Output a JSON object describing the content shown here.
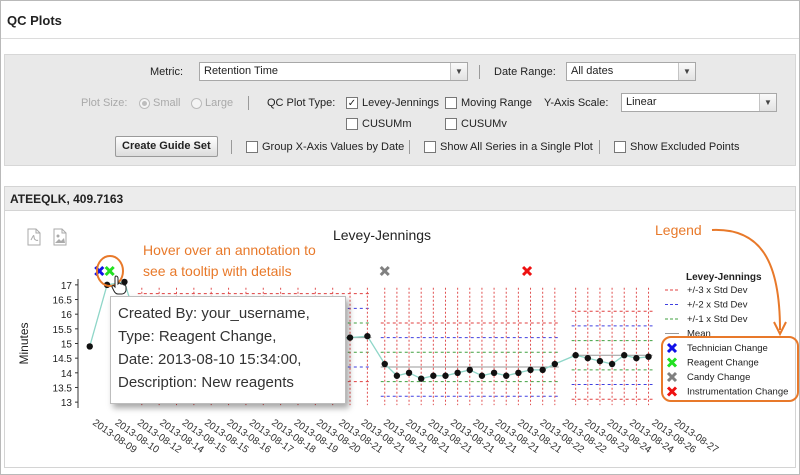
{
  "page": {
    "title": "QC Plots"
  },
  "controls": {
    "metric_label": "Metric:",
    "metric_value": "Retention Time",
    "date_range_label": "Date Range:",
    "date_range_value": "All dates",
    "plot_size_label": "Plot Size:",
    "plot_size_small": "Small",
    "plot_size_large": "Large",
    "qc_plot_type_label": "QC Plot Type:",
    "levey_jennings": "Levey-Jennings",
    "moving_range": "Moving Range",
    "cusumm": "CUSUMm",
    "cusumv": "CUSUMv",
    "y_axis_scale_label": "Y-Axis Scale:",
    "y_axis_scale_value": "Linear",
    "create_guide_set": "Create Guide Set",
    "group_x_axis": "Group X-Axis Values by Date",
    "show_all_series": "Show All Series in a Single Plot",
    "show_excluded": "Show Excluded Points"
  },
  "plot": {
    "header": "ATEEQLK, 409.7163",
    "callout_hover_line1": "Hover over an annotation to",
    "callout_hover_line2": "see a tooltip with details",
    "callout_legend": "Legend",
    "icons": [
      "pdf-export-icon",
      "png-export-icon",
      "pointer-hand-icon"
    ],
    "tooltip": {
      "created_by": "Created By: your_username,",
      "type": "Type: Reagent Change,",
      "date": "Date: 2013-08-10 15:34:00,",
      "description": "Description: New reagents"
    }
  },
  "chart_data": {
    "type": "line",
    "title": "Levey-Jennings",
    "ylabel": "Minutes",
    "xlabel": "",
    "ylim": [
      12.8,
      17.2
    ],
    "yticks": [
      13,
      13.5,
      14,
      14.5,
      15,
      15.5,
      16,
      16.5,
      17
    ],
    "x": [
      "2013-08-09",
      "2013-08-10",
      "2013-08-12",
      "2013-08-14",
      "2013-08-15",
      "2013-08-15",
      "2013-08-16",
      "2013-08-17",
      "2013-08-18",
      "2013-08-19",
      "2013-08-20",
      "2013-08-21",
      "2013-08-21",
      "2013-08-21",
      "2013-08-21",
      "2013-08-21",
      "2013-08-21",
      "2013-08-21",
      "2013-08-21",
      "2013-08-21",
      "2013-08-22",
      "2013-08-22",
      "2013-08-23",
      "2013-08-24",
      "2013-08-24",
      "2013-08-26",
      "2013-08-27"
    ],
    "xtick_labels": [
      "2013-08-09",
      "2013-08-10",
      "2013-08-12",
      "2013-08-14",
      "2013-08-15",
      "2013-08-15",
      "2013-08-16",
      "2013-08-17",
      "2013-08-18",
      "2013-08-19",
      "2013-08-20",
      "2013-08-21",
      "2013-08-21",
      "2013-08-21",
      "2013-08-21",
      "2013-08-21",
      "2013-08-21",
      "2013-08-21",
      "2013-08-21",
      "2013-08-21",
      "2013-08-22",
      "2013-08-22",
      "2013-08-23",
      "2013-08-24",
      "2013-08-24",
      "2013-08-26",
      "2013-08-27"
    ],
    "points": [
      {
        "x": 0,
        "y": 14.9
      },
      {
        "x": 1,
        "y": 17.0
      },
      {
        "x": 2,
        "y": 17.1
      },
      {
        "x": 3,
        "y": 15.2
      },
      {
        "x": 4,
        "y": 15.2
      },
      {
        "x": 5,
        "y": 15.2
      },
      {
        "x": 6,
        "y": 15.2
      },
      {
        "x": 7,
        "y": 15.2
      },
      {
        "x": 8,
        "y": 15.2
      },
      {
        "x": 9,
        "y": 15.2
      },
      {
        "x": 10,
        "y": 15.2
      },
      {
        "x": 11,
        "y": 15.2
      },
      {
        "x": 12,
        "y": 15.2
      },
      {
        "x": 13,
        "y": 15.15
      },
      {
        "x": 14,
        "y": 15.15
      },
      {
        "x": 15,
        "y": 15.2
      },
      {
        "x": 16,
        "y": 15.25
      },
      {
        "x": 17,
        "y": 14.3
      },
      {
        "x": 17.7,
        "y": 13.9
      },
      {
        "x": 18.4,
        "y": 14.0
      },
      {
        "x": 19.1,
        "y": 13.8
      },
      {
        "x": 19.8,
        "y": 13.9
      },
      {
        "x": 20.5,
        "y": 13.9
      },
      {
        "x": 21.2,
        "y": 14.0
      },
      {
        "x": 21.9,
        "y": 14.1
      },
      {
        "x": 22.6,
        "y": 13.9
      },
      {
        "x": 23.3,
        "y": 14.0
      },
      {
        "x": 24,
        "y": 13.9
      },
      {
        "x": 24.7,
        "y": 14.0
      },
      {
        "x": 25.4,
        "y": 14.1
      },
      {
        "x": 26.1,
        "y": 14.1
      },
      {
        "x": 26.8,
        "y": 14.3
      },
      {
        "x": 28,
        "y": 14.6
      },
      {
        "x": 28.7,
        "y": 14.5
      },
      {
        "x": 29.4,
        "y": 14.4
      },
      {
        "x": 30.1,
        "y": 14.3
      },
      {
        "x": 30.8,
        "y": 14.6
      },
      {
        "x": 31.5,
        "y": 14.5
      },
      {
        "x": 32.2,
        "y": 14.55
      }
    ],
    "annotations": [
      {
        "type": "Technician Change",
        "x": 0.55,
        "color": "#1010e8"
      },
      {
        "type": "Reagent Change",
        "x": 1.15,
        "color": "#22e022"
      },
      {
        "type": "Candy Change",
        "x": 17.0,
        "color": "#808080"
      },
      {
        "type": "Instrumentation Change",
        "x": 25.2,
        "color": "#ee1111"
      }
    ],
    "legend": {
      "placement": "right",
      "title": "Levey-Jennings",
      "items": [
        {
          "label": "+/-3 x Std Dev",
          "kind": "dash",
          "color": "#e04040"
        },
        {
          "label": "+/-2 x Std Dev",
          "kind": "dash",
          "color": "#4040e0"
        },
        {
          "label": "+/-1 x Std Dev",
          "kind": "dash",
          "color": "#40a040"
        },
        {
          "label": "Mean",
          "kind": "line",
          "color": "#999999"
        },
        {
          "label": "Technician Change",
          "kind": "x",
          "color": "#1010e8"
        },
        {
          "label": "Reagent Change",
          "kind": "x",
          "color": "#22e022"
        },
        {
          "label": "Candy Change",
          "kind": "x",
          "color": "#808080"
        },
        {
          "label": "Instrumentation Change",
          "kind": "x",
          "color": "#ee1111"
        }
      ]
    },
    "guide_sets": [
      {
        "mean": 15.2,
        "sd": 0.5
      },
      {
        "mean": 14.2,
        "sd": 0.5
      },
      {
        "mean": 14.6,
        "sd": 0.5
      }
    ]
  }
}
